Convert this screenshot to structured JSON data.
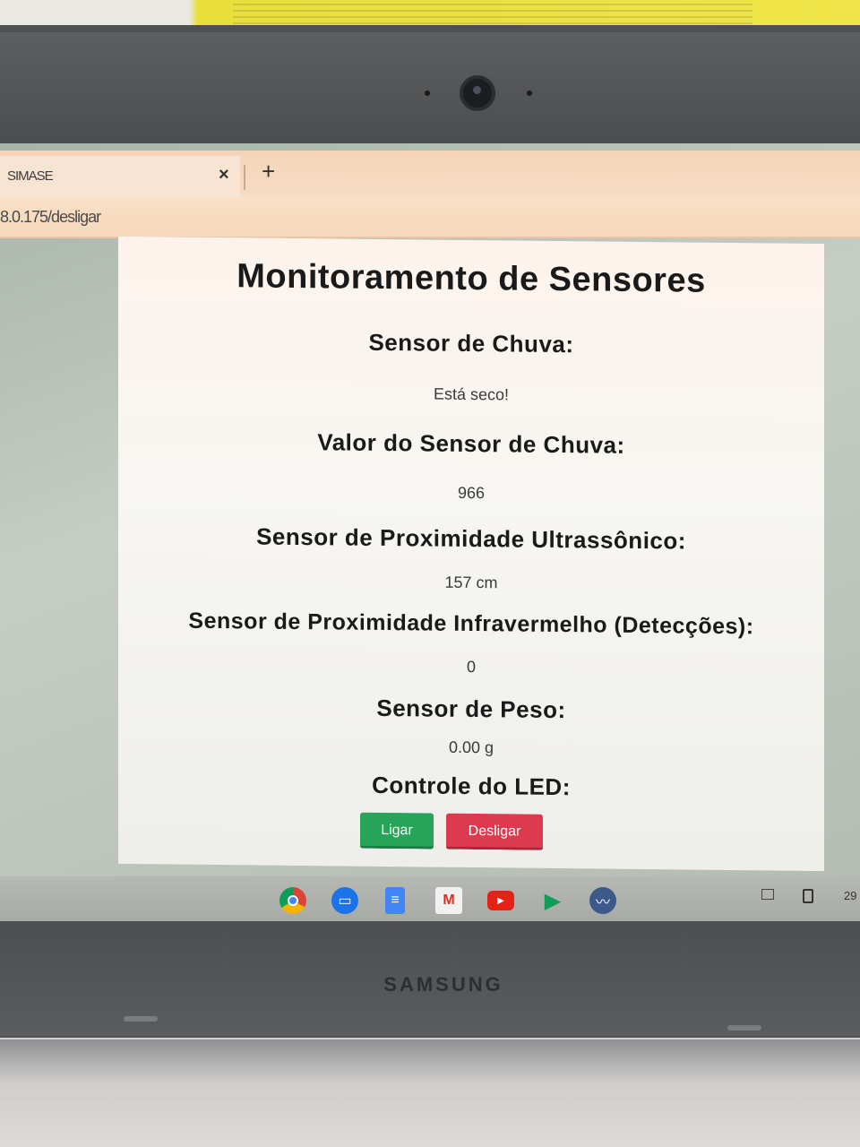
{
  "browser": {
    "tab_title": "SIMASE",
    "tab_close": "×",
    "new_tab": "+",
    "url": "8.0.175/desligar"
  },
  "page": {
    "title": "Monitoramento de Sensores",
    "sections": [
      {
        "heading": "Sensor de Chuva:",
        "value": "Está seco!"
      },
      {
        "heading": "Valor do Sensor de Chuva:",
        "value": "966"
      },
      {
        "heading": "Sensor de Proximidade Ultrassônico:",
        "value": "157 cm"
      },
      {
        "heading": "Sensor de Proximidade Infravermelho (Detecções):",
        "value": "0"
      },
      {
        "heading": "Sensor de Peso:",
        "value": "0.00 g"
      }
    ],
    "led_heading": "Controle do LED:",
    "btn_on": "Ligar",
    "btn_off": "Desligar",
    "colors": {
      "on": "#27a35a",
      "off": "#dc3a4e"
    }
  },
  "shelf": {
    "apps": [
      "chrome-icon",
      "files-icon",
      "docs-icon",
      "gmail-icon",
      "youtube-icon",
      "play-store-icon",
      "activity-icon"
    ],
    "clock": "29"
  },
  "device": {
    "brand": "SAMSUNG"
  }
}
